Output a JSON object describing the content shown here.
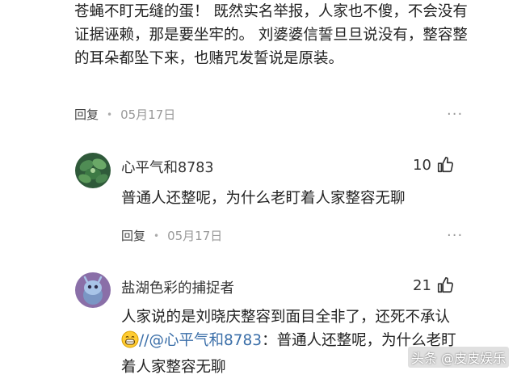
{
  "prev_comment": {
    "text": "苍蝇不盯无缝的蛋！ 既然实名举报，人家也不傻，不会没有证据诬赖，那是要坐牢的。 刘婆婆信誓旦旦说没有，整容整的耳朵都坠下来，也赌咒发誓说是原装。",
    "reply_label": "回复",
    "date": "05月17日",
    "more": "···"
  },
  "reply1": {
    "username": "心平气和8783",
    "likes": "10",
    "text": "普通人还整呢，为什么老盯着人家整容无聊",
    "reply_label": "回复",
    "date": "05月17日",
    "more": "···"
  },
  "reply2": {
    "username": "盐湖色彩的捕捉者",
    "likes": "21",
    "text_before": "人家说的是刘晓庆整容到面目全非了，还死不承认",
    "mention_sep": "//",
    "mention": "@心平气和8783",
    "text_after": "：普通人还整呢，为什么老盯着人家整容无聊"
  },
  "watermark": "头条 @皮皮娱乐",
  "icons": {
    "like": "thumbs-up-icon",
    "more": "more-icon",
    "emoji": "grin-emoji-icon"
  }
}
